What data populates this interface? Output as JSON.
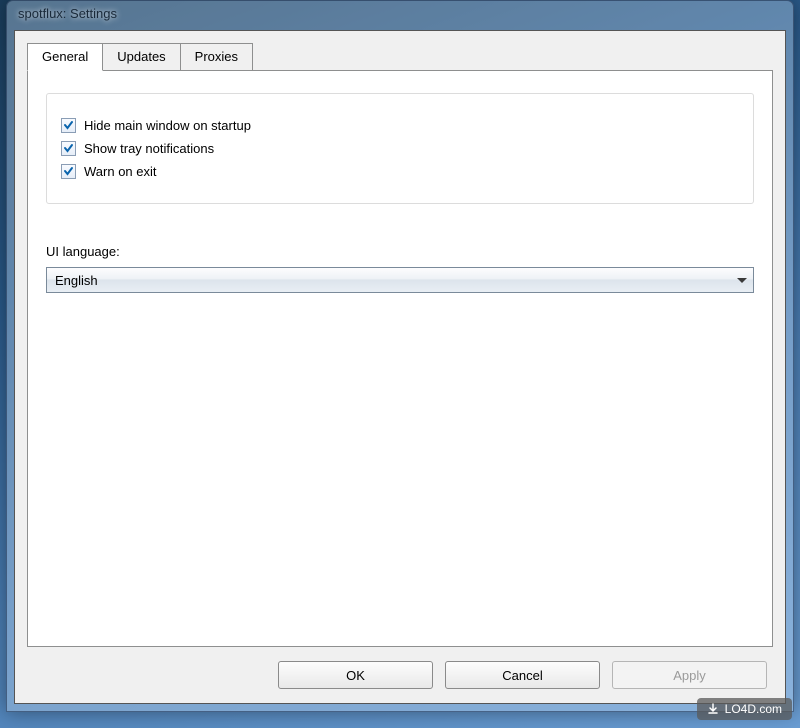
{
  "window": {
    "title": "spotflux: Settings"
  },
  "tabs": [
    {
      "label": "General",
      "active": true
    },
    {
      "label": "Updates",
      "active": false
    },
    {
      "label": "Proxies",
      "active": false
    }
  ],
  "general": {
    "checkboxes": [
      {
        "label": "Hide main window on startup",
        "checked": true
      },
      {
        "label": "Show tray notifications",
        "checked": true
      },
      {
        "label": "Warn on exit",
        "checked": true
      }
    ],
    "language_label": "UI language:",
    "language_value": "English"
  },
  "buttons": {
    "ok": "OK",
    "cancel": "Cancel",
    "apply": "Apply"
  },
  "watermark": "LO4D.com"
}
